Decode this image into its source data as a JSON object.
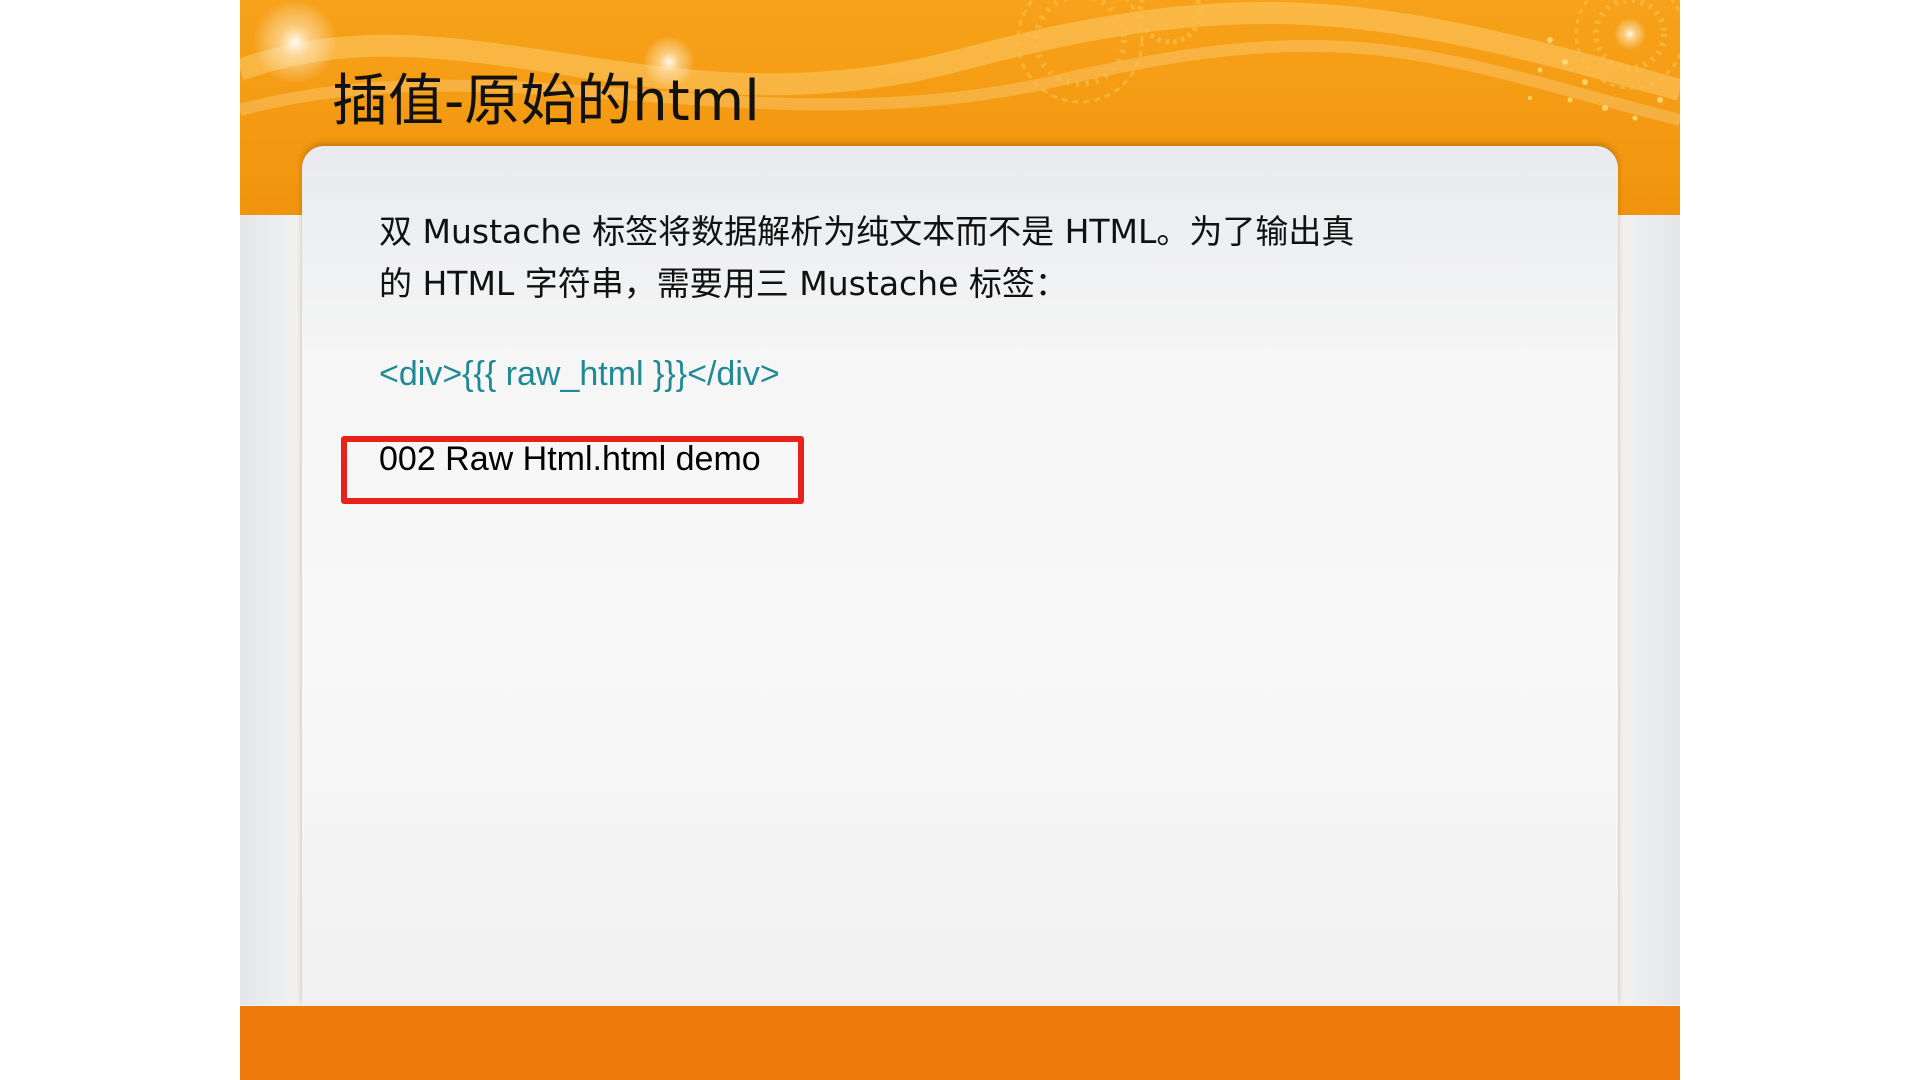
{
  "slide": {
    "title": "插值-原始的html",
    "body_line_1": "双 Mustache 标签将数据解析为纯文本而不是 HTML。为了输出真",
    "body_line_2": "的 HTML 字符串，需要用三 Mustache 标签：",
    "code_example": "<div>{{{ raw_html }}}</div>",
    "demo_link": "002 Raw Html.html demo"
  },
  "colors": {
    "header_orange": "#f39a12",
    "footer_orange": "#ee7a0b",
    "code_teal": "#1f8a95",
    "highlight_red": "#e8221b",
    "text_black": "#111111"
  }
}
